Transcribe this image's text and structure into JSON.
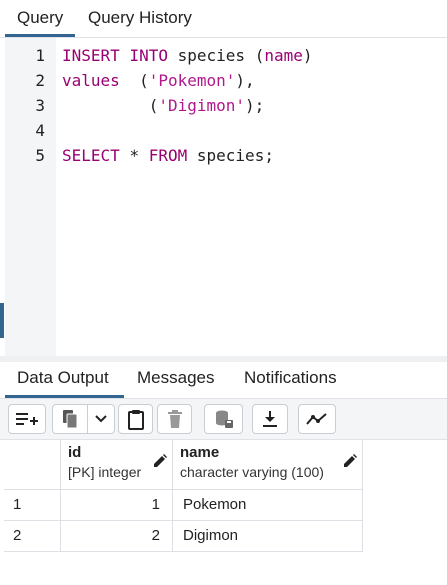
{
  "query_tabs": [
    {
      "label": "Query"
    },
    {
      "label": "Query History"
    }
  ],
  "editor": {
    "line_numbers": [
      "1",
      "2",
      "3",
      "4",
      "5"
    ],
    "line1": {
      "kw1": "INSERT",
      "kw2": "INTO",
      "ident": "species",
      "paren_open": "(",
      "col": "name",
      "paren_close": ")"
    },
    "line2": {
      "kw": "values",
      "open": "(",
      "str": "'Pokemon'",
      "close": "),"
    },
    "line3": {
      "open": "(",
      "str": "'Digimon'",
      "close": ");"
    },
    "line5": {
      "kw1": "SELECT",
      "star": "*",
      "kw2": "FROM",
      "ident": "species;"
    }
  },
  "output_tabs": [
    {
      "label": "Data Output"
    },
    {
      "label": "Messages"
    },
    {
      "label": "Notifications"
    }
  ],
  "toolbar": {
    "icons": [
      "add-row-icon",
      "copy-icon",
      "chevron-down-icon",
      "paste-icon",
      "delete-icon",
      "save-data-icon",
      "download-icon",
      "graph-icon"
    ]
  },
  "table": {
    "columns": [
      {
        "name": "id",
        "type": "[PK] integer"
      },
      {
        "name": "name",
        "type": "character varying (100)"
      }
    ],
    "rows": [
      {
        "num": "1",
        "id": "1",
        "name": "Pokemon"
      },
      {
        "num": "2",
        "id": "2",
        "name": "Digimon"
      }
    ]
  },
  "colors": {
    "accent": "#326690",
    "keyword": "#990073",
    "string": "#b0188c"
  }
}
